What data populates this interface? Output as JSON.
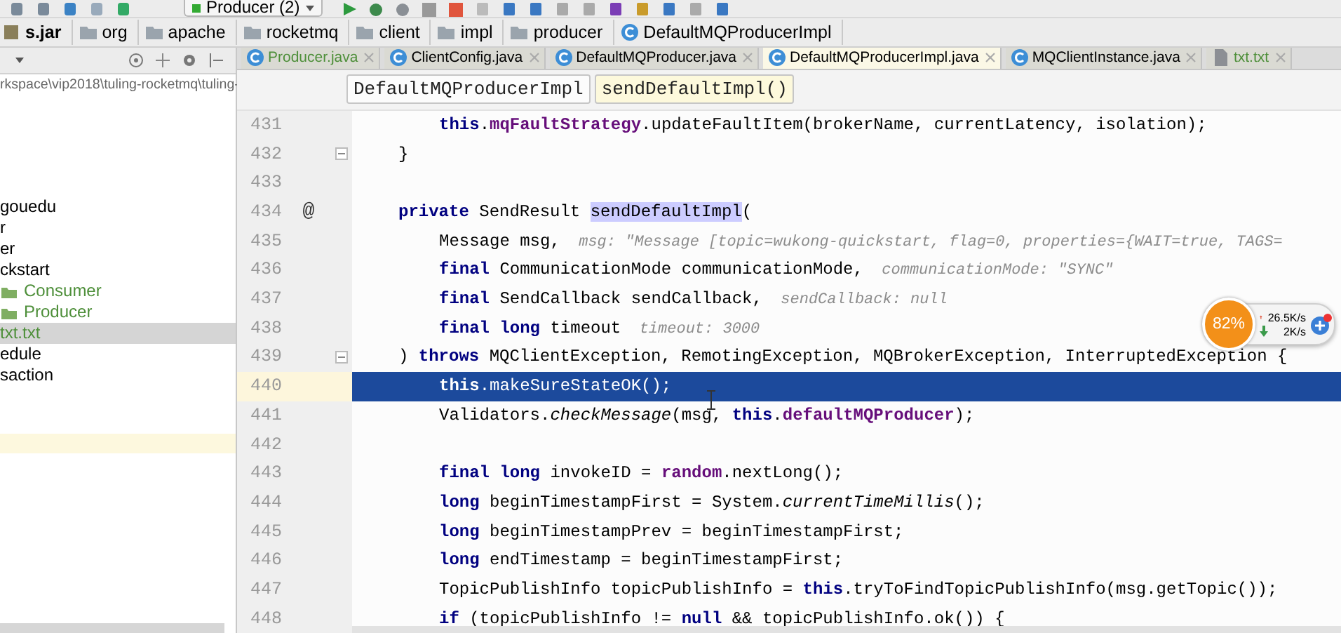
{
  "toolbar": {
    "run_config": "Producer (2)"
  },
  "breadcrumb": [
    {
      "text": "s.jar",
      "kind": "jar"
    },
    {
      "text": "org",
      "kind": "folder"
    },
    {
      "text": "apache",
      "kind": "folder"
    },
    {
      "text": "rocketmq",
      "kind": "folder"
    },
    {
      "text": "client",
      "kind": "folder"
    },
    {
      "text": "impl",
      "kind": "folder"
    },
    {
      "text": "producer",
      "kind": "folder"
    },
    {
      "text": "DefaultMQProducerImpl",
      "kind": "class"
    }
  ],
  "project_panel": {
    "path": "rkspace\\vip2018\\tuling-rocketmq\\tuling-",
    "items": [
      {
        "text": "gouedu",
        "kind": "plain",
        "color": "#000000",
        "selected": false
      },
      {
        "text": "r",
        "kind": "plain",
        "color": "#000000",
        "selected": false
      },
      {
        "text": "er",
        "kind": "plain",
        "color": "#000000",
        "selected": false
      },
      {
        "text": "ckstart",
        "kind": "plain",
        "color": "#000000",
        "selected": false,
        "children": [
          {
            "text": "Consumer",
            "kind": "package",
            "color": "#4e8f3a",
            "selected": false
          },
          {
            "text": "Producer",
            "kind": "package",
            "color": "#4e8f3a",
            "selected": false
          }
        ]
      },
      {
        "text": "txt.txt",
        "kind": "plain",
        "color": "#4e8f3a",
        "selected": true
      },
      {
        "text": "edule",
        "kind": "plain",
        "color": "#000000",
        "selected": false
      },
      {
        "text": "saction",
        "kind": "plain",
        "color": "#000000",
        "selected": false
      }
    ]
  },
  "tabs": [
    {
      "label": "Producer.java",
      "kind": "class",
      "color": "#4e8f3a",
      "selected": false
    },
    {
      "label": "ClientConfig.java",
      "kind": "class",
      "color": "#000000",
      "selected": false
    },
    {
      "label": "DefaultMQProducer.java",
      "kind": "class",
      "color": "#000000",
      "selected": false
    },
    {
      "label": "DefaultMQProducerImpl.java",
      "kind": "class",
      "color": "#000000",
      "selected": true
    },
    {
      "label": "MQClientInstance.java",
      "kind": "class",
      "color": "#000000",
      "selected": false
    },
    {
      "label": "txt.txt",
      "kind": "text",
      "color": "#4e8f3a",
      "selected": false
    }
  ],
  "method_crumbs": [
    {
      "text": "DefaultMQProducerImpl",
      "selected": false
    },
    {
      "text": "sendDefaultImpl()",
      "selected": true
    }
  ],
  "lines": [
    {
      "number": "431",
      "kind": "statement",
      "selected": false,
      "fold": false,
      "tokens": [
        {
          "kind": "kw",
          "text": "this"
        },
        {
          "kind": "plain",
          "text": "."
        },
        {
          "kind": "field",
          "text": "mqFaultStrategy"
        },
        {
          "kind": "plain",
          "text": ".updateFaultItem(brokerName, currentLatency, isolation);"
        }
      ]
    },
    {
      "number": "432",
      "kind": "member",
      "selected": false,
      "fold": true,
      "tokens": [
        {
          "kind": "plain",
          "text": "}"
        }
      ]
    },
    {
      "number": "433",
      "kind": "member",
      "selected": false,
      "fold": false
    },
    {
      "number": "434",
      "kind": "member",
      "selected": false,
      "fold": false,
      "marker": "@",
      "tokens": [
        {
          "kind": "kw",
          "text": "private"
        },
        {
          "kind": "plain",
          "text": " SendResult "
        },
        {
          "kind": "match",
          "text": "sendDefaultImpl"
        },
        {
          "kind": "plain",
          "text": "("
        }
      ]
    },
    {
      "number": "435",
      "kind": "statement",
      "selected": false,
      "fold": false,
      "tokens": [
        {
          "kind": "plain",
          "text": "Message msg,"
        },
        {
          "kind": "hint",
          "text": "msg: \"Message [topic=wukong-quickstart, flag=0, properties={WAIT=true, TAGS="
        }
      ]
    },
    {
      "number": "436",
      "kind": "statement",
      "selected": false,
      "fold": false,
      "tokens": [
        {
          "kind": "kw",
          "text": "final"
        },
        {
          "kind": "plain",
          "text": " CommunicationMode communicationMode,"
        },
        {
          "kind": "hint",
          "text": "communicationMode: \"SYNC\""
        }
      ]
    },
    {
      "number": "437",
      "kind": "statement",
      "selected": false,
      "fold": false,
      "tokens": [
        {
          "kind": "kw",
          "text": "final"
        },
        {
          "kind": "plain",
          "text": " SendCallback sendCallback,"
        },
        {
          "kind": "hint",
          "text": "sendCallback: null"
        }
      ]
    },
    {
      "number": "438",
      "kind": "statement",
      "selected": false,
      "fold": false,
      "tokens": [
        {
          "kind": "kw",
          "text": "final long"
        },
        {
          "kind": "plain",
          "text": " timeout"
        },
        {
          "kind": "hint",
          "text": "timeout: 3000"
        }
      ]
    },
    {
      "number": "439",
      "kind": "member",
      "selected": false,
      "fold": true,
      "tokens": [
        {
          "kind": "plain",
          "text": ") "
        },
        {
          "kind": "kw",
          "text": "throws"
        },
        {
          "kind": "plain",
          "text": " MQClientException, RemotingException, MQBrokerException, InterruptedException {"
        }
      ]
    },
    {
      "number": "440",
      "kind": "statement",
      "selected": true,
      "fold": false,
      "tokens": [
        {
          "kind": "kw",
          "text": "this"
        },
        {
          "kind": "plain",
          "text": ".makeSureStateOK();"
        }
      ]
    },
    {
      "number": "441",
      "kind": "statement",
      "selected": false,
      "fold": false,
      "tokens": [
        {
          "kind": "plain",
          "text": "Validators."
        },
        {
          "kind": "static",
          "text": "checkMessage"
        },
        {
          "kind": "plain",
          "text": "(msg, "
        },
        {
          "kind": "kw",
          "text": "this"
        },
        {
          "kind": "plain",
          "text": "."
        },
        {
          "kind": "field",
          "text": "defaultMQProducer"
        },
        {
          "kind": "plain",
          "text": ");"
        }
      ]
    },
    {
      "number": "442",
      "kind": "statement",
      "selected": false,
      "fold": false
    },
    {
      "number": "443",
      "kind": "statement",
      "selected": false,
      "fold": false,
      "tokens": [
        {
          "kind": "kw",
          "text": "final long"
        },
        {
          "kind": "plain",
          "text": " invokeID = "
        },
        {
          "kind": "field",
          "text": "random"
        },
        {
          "kind": "plain",
          "text": ".nextLong();"
        }
      ]
    },
    {
      "number": "444",
      "kind": "statement",
      "selected": false,
      "fold": false,
      "tokens": [
        {
          "kind": "kw",
          "text": "long"
        },
        {
          "kind": "plain",
          "text": " beginTimestampFirst = System."
        },
        {
          "kind": "static",
          "text": "currentTimeMillis"
        },
        {
          "kind": "plain",
          "text": "();"
        }
      ]
    },
    {
      "number": "445",
      "kind": "statement",
      "selected": false,
      "fold": false,
      "tokens": [
        {
          "kind": "kw",
          "text": "long"
        },
        {
          "kind": "plain",
          "text": " beginTimestampPrev = beginTimestampFirst;"
        }
      ]
    },
    {
      "number": "446",
      "kind": "statement",
      "selected": false,
      "fold": false,
      "tokens": [
        {
          "kind": "kw",
          "text": "long"
        },
        {
          "kind": "plain",
          "text": " endTimestamp = beginTimestampFirst;"
        }
      ]
    },
    {
      "number": "447",
      "kind": "statement",
      "selected": false,
      "fold": false,
      "tokens": [
        {
          "kind": "plain",
          "text": "TopicPublishInfo topicPublishInfo = "
        },
        {
          "kind": "kw",
          "text": "this"
        },
        {
          "kind": "plain",
          "text": ".tryToFindTopicPublishInfo(msg.getTopic());"
        }
      ]
    },
    {
      "number": "448",
      "kind": "statement",
      "selected": false,
      "fold": false,
      "tokens": [
        {
          "kind": "kw",
          "text": "if"
        },
        {
          "kind": "plain",
          "text": " (topicPublishInfo != "
        },
        {
          "kind": "kw",
          "text": "null"
        },
        {
          "kind": "plain",
          "text": " && topicPublishInfo.ok()) {"
        }
      ]
    }
  ],
  "net_widget": {
    "percent": "82%",
    "upload": "26.5K/s",
    "download": "2K/s"
  }
}
